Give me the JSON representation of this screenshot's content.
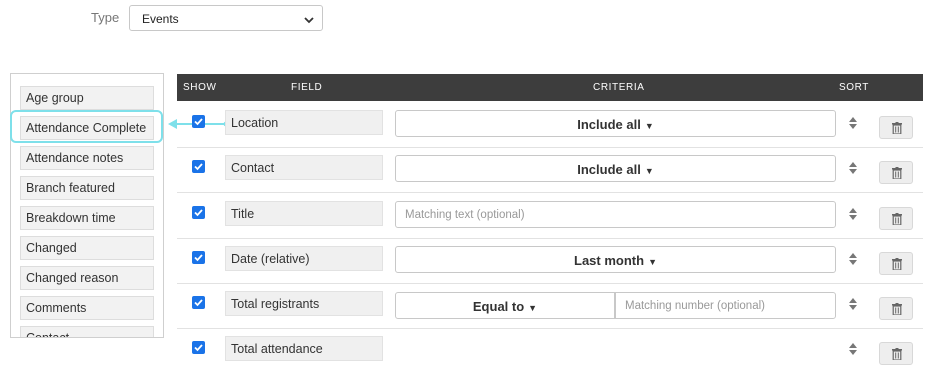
{
  "type_filter": {
    "label": "Type",
    "value": "Events"
  },
  "field_list": [
    "Age group",
    "Attendance Complete",
    "Attendance notes",
    "Branch featured",
    "Breakdown time",
    "Changed",
    "Changed reason",
    "Comments",
    "Contact"
  ],
  "table": {
    "headers": {
      "show": "SHOW",
      "field": "FIELD",
      "criteria": "CRITERIA",
      "sort": "SORT"
    },
    "rows": [
      {
        "field": "Location",
        "show": true,
        "criteria_type": "select",
        "criteria": "Include all"
      },
      {
        "field": "Contact",
        "show": true,
        "criteria_type": "select",
        "criteria": "Include all"
      },
      {
        "field": "Title",
        "show": true,
        "criteria_type": "text",
        "placeholder": "Matching text (optional)"
      },
      {
        "field": "Date (relative)",
        "show": true,
        "criteria_type": "select",
        "criteria": "Last month"
      },
      {
        "field": "Total registrants",
        "show": true,
        "criteria_type": "number",
        "operator": "Equal to",
        "placeholder": "Matching number (optional)"
      },
      {
        "field": "Total attendance",
        "show": true,
        "criteria_type": "none"
      }
    ]
  },
  "colors": {
    "header_bg": "#3d3d3d",
    "checkbox": "#1a73e8",
    "highlight": "#7ee0ea"
  }
}
